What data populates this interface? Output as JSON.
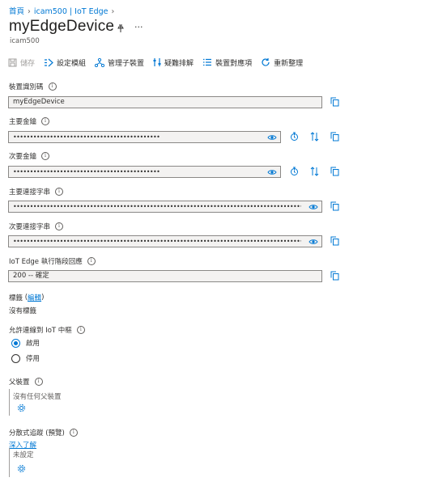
{
  "breadcrumb": {
    "home": "首頁",
    "hub": "icam500 | IoT Edge"
  },
  "page": {
    "title": "myEdgeDevice",
    "subtitle": "icam500"
  },
  "toolbar": {
    "save": "儲存",
    "set_modules": "設定模組",
    "manage_children": "管理子裝置",
    "troubleshoot": "疑難排解",
    "device_twin": "裝置對應項",
    "refresh": "重新整理"
  },
  "fields": {
    "device_id": {
      "label": "裝置識別碼",
      "value": "myEdgeDevice"
    },
    "primary_key": {
      "label": "主要金鑰",
      "value": "••••••••••••••••••••••••••••••••••••••••••••"
    },
    "secondary_key": {
      "label": "次要金鑰",
      "value": "••••••••••••••••••••••••••••••••••••••••••••"
    },
    "primary_conn": {
      "label": "主要連接字串",
      "value": "••••••••••••••••••••••••••••••••••••••••••••••••••••••••••••••••••••••••••••••••••••••••••••••••..."
    },
    "secondary_conn": {
      "label": "次要連接字串",
      "value": "••••••••••••••••••••••••••••••••••••••••••••••••••••••••••••••••••••••••••••••••••••••••••••••••..."
    },
    "runtime_response": {
      "label": "IoT Edge 執行階段回應",
      "value": "200 -- 確定"
    }
  },
  "tags": {
    "label": "標籤",
    "edit_link": "編輯",
    "lparen": "(",
    "rparen": ")",
    "value": "沒有標籤"
  },
  "hub_connection": {
    "label": "允許連線到 IoT 中樞",
    "options": [
      "啟用",
      "停用"
    ],
    "selected": "啟用"
  },
  "parent_device": {
    "label": "父裝置",
    "value": "沒有任何父裝置"
  },
  "distributed_tracing": {
    "label": "分散式追蹤 (預覽)",
    "learn_more": "深入了解",
    "value": "未設定"
  },
  "icons": {
    "pin": "pin-icon",
    "more": "more-icon",
    "info": "info-icon",
    "copy": "copy-icon",
    "eye": "eye-icon",
    "regenerate": "regenerate-icon",
    "swap": "swap-keys-icon",
    "gear": "gear-icon"
  },
  "colors": {
    "accent": "#0078d4",
    "field_bg": "#f3f2f1",
    "field_border": "#8a8886"
  }
}
